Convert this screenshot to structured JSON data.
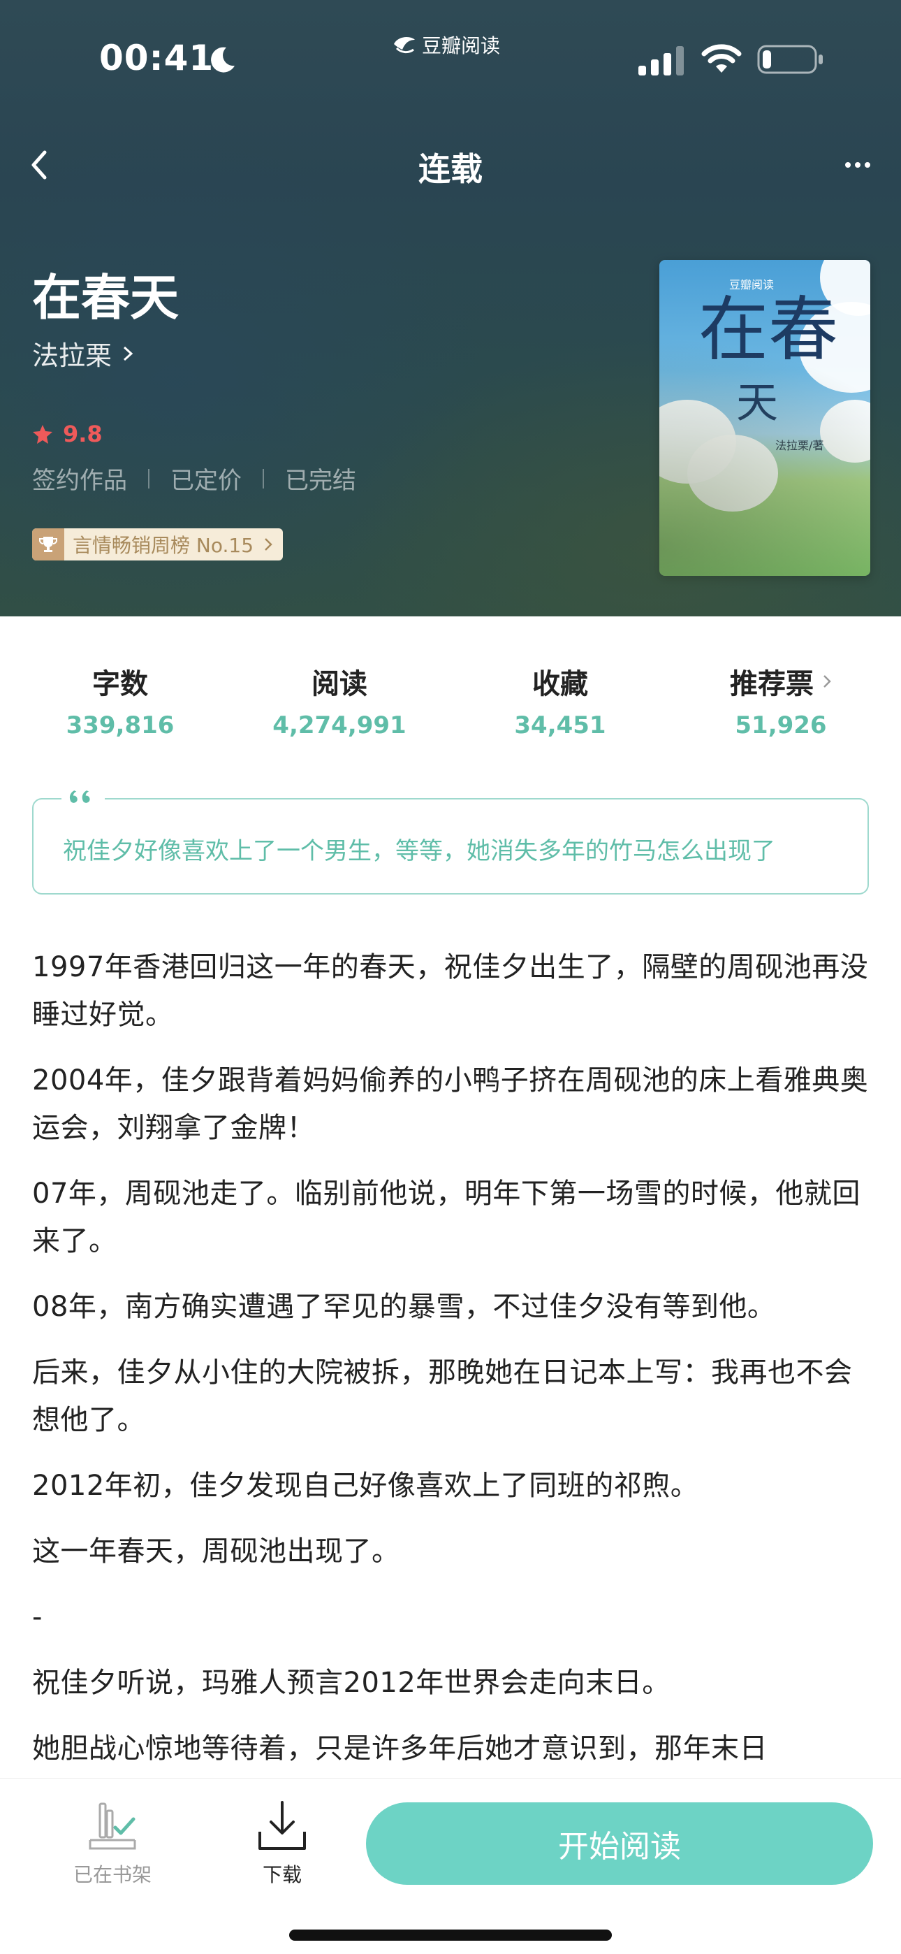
{
  "status_bar": {
    "time": "00:41",
    "brand": "豆瓣阅读"
  },
  "nav": {
    "title": "连载"
  },
  "book": {
    "title": "在春天",
    "author": "法拉栗",
    "rating": "9.8",
    "tags": [
      "签约作品",
      "已定价",
      "已完结"
    ],
    "rank": "言情畅销周榜 No.15",
    "cover": {
      "title_main": "在春",
      "title_sub": "天",
      "brand": "豆瓣阅读",
      "author": "法拉栗/著"
    }
  },
  "stats": [
    {
      "label": "字数",
      "value": "339,816"
    },
    {
      "label": "阅读",
      "value": "4,274,991"
    },
    {
      "label": "收藏",
      "value": "34,451"
    },
    {
      "label": "推荐票",
      "value": "51,926"
    }
  ],
  "quote": "祝佳夕好像喜欢上了一个男生，等等，她消失多年的竹马怎么出现了",
  "summary": [
    "1997年香港回归这一年的春天，祝佳夕出生了，隔壁的周砚池再没睡过好觉。",
    "2004年，佳夕跟背着妈妈偷养的小鸭子挤在周砚池的床上看雅典奥运会，刘翔拿了金牌！",
    "07年，周砚池走了。临别前他说，明年下第一场雪的时候，他就回来了。",
    "08年，南方确实遭遇了罕见的暴雪，不过佳夕没有等到他。",
    "后来，佳夕从小住的大院被拆，那晚她在日记本上写：我再也不会想他了。",
    "2012年初，佳夕发现自己好像喜欢上了同班的祁煦。",
    "这一年春天，周砚池出现了。",
    "-",
    "祝佳夕听说，玛雅人预言2012年世界会走向末日。",
    "她胆战心惊地等待着，只是许多年后她才意识到，那年末日"
  ],
  "bottom": {
    "shelf_label": "已在书架",
    "download_label": "下载",
    "start_label": "开始阅读"
  },
  "colors": {
    "accent": "#6dd3c5",
    "stat_value": "#5fbda8",
    "rating": "#ef5a5a"
  }
}
